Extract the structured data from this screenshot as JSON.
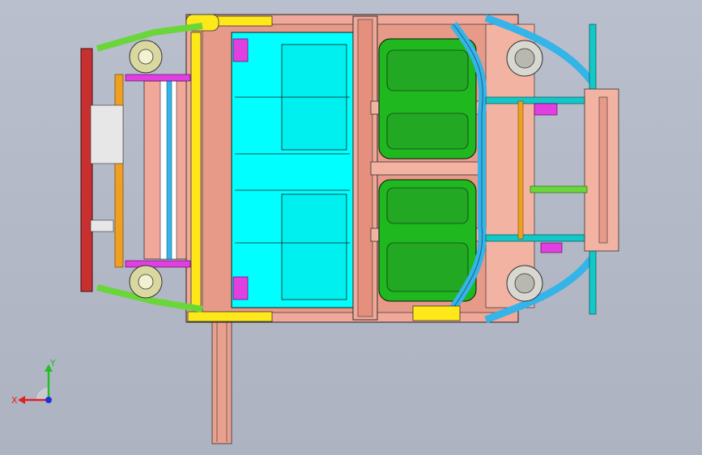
{
  "viewer": {
    "background_top": "#b9bfcc",
    "background_bottom": "#adb3c1"
  },
  "model": {
    "part_colors": {
      "floor_panel": "#f0a89a",
      "floor_inner": "#e5917f",
      "cyan_panel": "#00ffff",
      "green_panel": "#1fb81f",
      "yellow_rail": "#ffe81a",
      "red_bumper": "#c83030",
      "magenta_bracket": "#e040e0",
      "blue_rail": "#34b4e8",
      "teal_bar": "#12c8c8",
      "green_arm": "#6ad63a",
      "orange_bar": "#f0a020",
      "mount_grey": "#d8d8d0"
    }
  },
  "triad": {
    "x_label": "X",
    "y_label": "Y",
    "x_color": "#e02020",
    "y_color": "#20c020",
    "z_color": "#2030e0",
    "icon": "coordinate-triad-icon"
  }
}
